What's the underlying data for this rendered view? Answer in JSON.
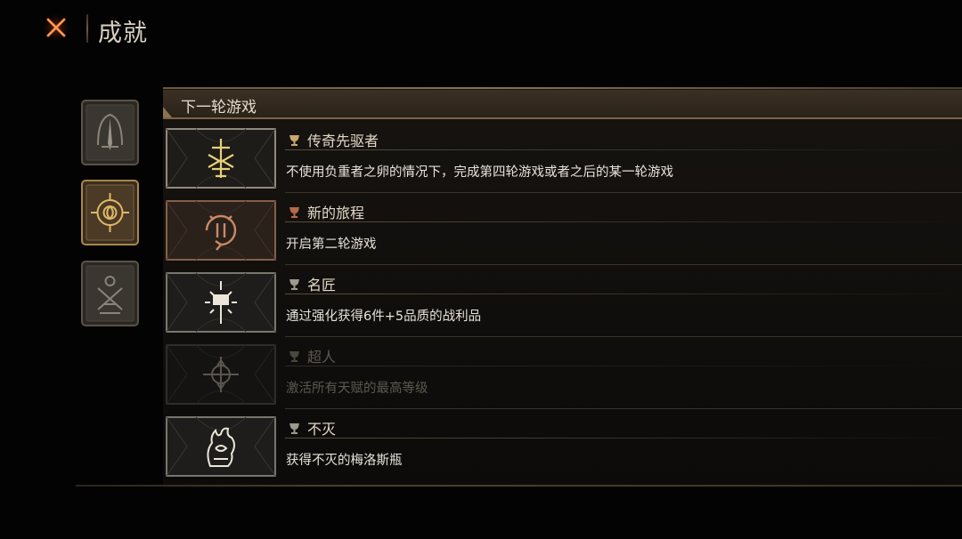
{
  "header": {
    "title": "成就",
    "close_icon": "close-x-icon",
    "accent_color": "#e0592a"
  },
  "tabs": [
    {
      "icon": "spire-arch-icon",
      "selected": false
    },
    {
      "icon": "compass-sigil-icon",
      "selected": true
    },
    {
      "icon": "crossed-weapons-icon",
      "selected": false
    }
  ],
  "section": {
    "title": "下一轮游戏"
  },
  "achievements": [
    {
      "name": "传奇先驱者",
      "description": "不使用负重者之卵的情况下，完成第四轮游戏或者之后的某一轮游戏",
      "icon": "sword-rune-icon",
      "unlocked": true,
      "icon_color": "#e8cf7a"
    },
    {
      "name": "新的旅程",
      "description": "开启第二轮游戏",
      "icon": "cycle-portal-icon",
      "unlocked": true,
      "icon_color": "#c07a5a"
    },
    {
      "name": "名匠",
      "description": "通过强化获得6件+5品质的战利品",
      "icon": "radiant-hammer-icon",
      "unlocked": true,
      "icon_color": "#e6e0d4"
    },
    {
      "name": "超人",
      "description": "激活所有天赋的最高等级",
      "icon": "star-ring-icon",
      "unlocked": false,
      "icon_color": "#5a554e"
    },
    {
      "name": "不灭",
      "description": "获得不灭的梅洛斯瓶",
      "icon": "flame-hand-icon",
      "unlocked": true,
      "icon_color": "#e6e0d4"
    }
  ]
}
